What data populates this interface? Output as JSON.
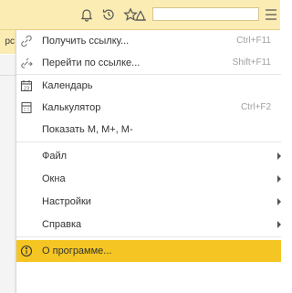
{
  "toolbar": {
    "icons": [
      "bell-icon",
      "history-icon",
      "star-icon",
      "favorites-folder-icon",
      "menu-icon"
    ],
    "search_value": ""
  },
  "left_tab": {
    "label": "рс"
  },
  "menu": {
    "items": [
      {
        "label": "Получить ссылку...",
        "shortcut": "Ctrl+F11",
        "icon": "link-icon"
      },
      {
        "label": "Перейти по ссылке...",
        "shortcut": "Shift+F11",
        "icon": "go-to-link-icon"
      },
      {
        "label": "Календарь",
        "shortcut": "",
        "icon": "calendar-icon"
      },
      {
        "label": "Калькулятор",
        "shortcut": "Ctrl+F2",
        "icon": "calculator-icon"
      },
      {
        "label": "Показать М, М+, М-",
        "shortcut": "",
        "icon": ""
      },
      {
        "label": "Файл",
        "submenu": true
      },
      {
        "label": "Окна",
        "submenu": true
      },
      {
        "label": "Настройки",
        "submenu": true
      },
      {
        "label": "Справка",
        "submenu": true
      },
      {
        "label": "О программе...",
        "icon": "info-icon",
        "highlighted": true
      }
    ]
  },
  "colors": {
    "toolbar_bg": "#fbecb4",
    "highlight": "#f5c623",
    "text": "#333333",
    "shortcut_text": "#a0a0a0"
  }
}
